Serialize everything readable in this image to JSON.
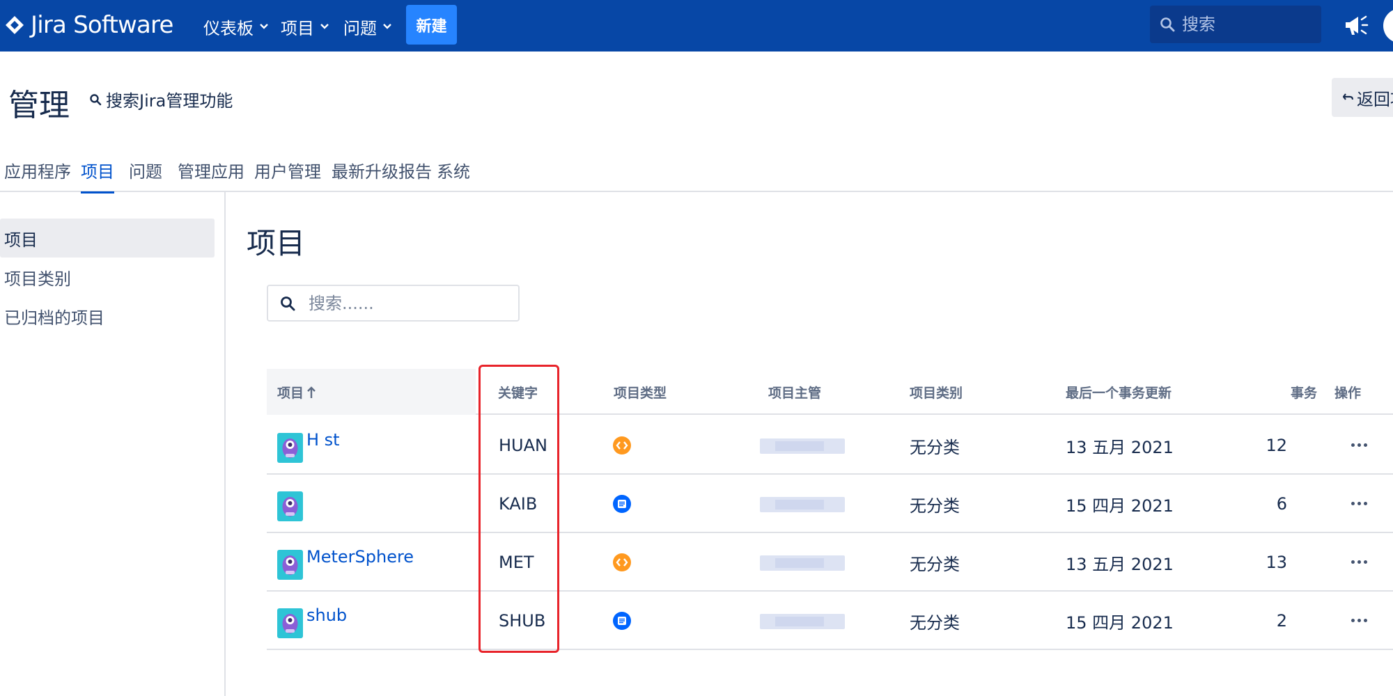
{
  "app": {
    "name": "Jira Software"
  },
  "topnav": {
    "items": [
      {
        "label": "仪表板"
      },
      {
        "label": "项目"
      },
      {
        "label": "问题"
      }
    ],
    "create_label": "新建",
    "search_placeholder": "搜索"
  },
  "admin": {
    "title": "管理",
    "search_link": "搜索Jira管理功能",
    "return_label": "返回项"
  },
  "tabs": [
    {
      "label": "应用程序"
    },
    {
      "label": "项目"
    },
    {
      "label": "问题"
    },
    {
      "label": "管理应用"
    },
    {
      "label": "用户管理"
    },
    {
      "label": "最新升级报告"
    },
    {
      "label": "系统"
    }
  ],
  "sidebar": {
    "items": [
      {
        "label": "项目"
      },
      {
        "label": "项目类别"
      },
      {
        "label": "已归档的项目"
      }
    ]
  },
  "main": {
    "title": "项目",
    "filter_placeholder": "搜索......",
    "columns": {
      "project": "项目",
      "key": "关键字",
      "type": "项目类型",
      "lead": "项目主管",
      "category": "项目类别",
      "last_update": "最后一个事务更新",
      "issues": "事务",
      "actions": "操作"
    },
    "rows": [
      {
        "name": "H         st",
        "key": "HUAN",
        "type_icon": "software-code-icon",
        "category": "无分类",
        "last_update": "13 五月 2021",
        "issues": "12"
      },
      {
        "name": "",
        "key": "KAIB",
        "type_icon": "business-doc-icon",
        "category": "无分类",
        "last_update": "15 四月 2021",
        "issues": "6"
      },
      {
        "name": "MeterSphere",
        "key": "MET",
        "type_icon": "software-code-icon",
        "category": "无分类",
        "last_update": "13 五月 2021",
        "issues": "13"
      },
      {
        "name": "shub",
        "key": "SHUB",
        "type_icon": "business-doc-icon",
        "category": "无分类",
        "last_update": "15 四月 2021",
        "issues": "2"
      }
    ]
  },
  "colors": {
    "topbar": "#0747a6",
    "create_button": "#2684ff",
    "link": "#0052cc",
    "software_type": "#ff991f",
    "business_type": "#0065ff",
    "highlight_box": "#e8232a"
  }
}
